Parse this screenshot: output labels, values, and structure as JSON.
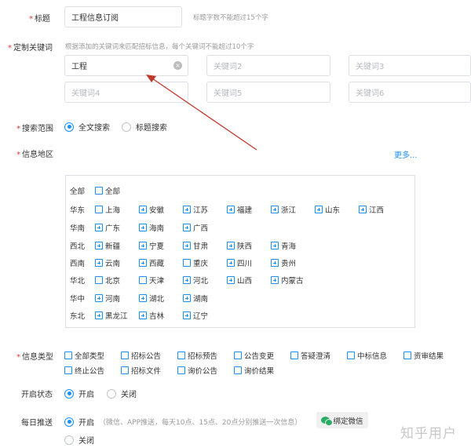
{
  "title_field": {
    "label": "标题",
    "value": "工程信息订阅",
    "hint": "标题字数不能超过15个字"
  },
  "keywords": {
    "label": "定制关键词",
    "hint": "根据添加的关键词来匹配招标信息，每个关键词不能超过10个字",
    "items": [
      {
        "value": "工程",
        "placeholder": ""
      },
      {
        "value": "",
        "placeholder": "关键词2"
      },
      {
        "value": "",
        "placeholder": "关键词3"
      },
      {
        "value": "",
        "placeholder": "关键词4"
      },
      {
        "value": "",
        "placeholder": "关键词5"
      },
      {
        "value": "",
        "placeholder": "关键词6"
      }
    ]
  },
  "search_scope": {
    "label": "搜索范围",
    "options": [
      {
        "label": "全文搜索",
        "selected": true
      },
      {
        "label": "标题搜索",
        "selected": false
      }
    ]
  },
  "region": {
    "label": "信息地区",
    "more": "更多...",
    "rows": [
      {
        "name": "全部",
        "items": [
          "全部"
        ]
      },
      {
        "name": "华东",
        "items": [
          "上海",
          "安徽",
          "江苏",
          "福建",
          "浙江",
          "山东",
          "江西"
        ]
      },
      {
        "name": "华南",
        "items": [
          "广东",
          "海南",
          "广西"
        ]
      },
      {
        "name": "西北",
        "items": [
          "新疆",
          "宁夏",
          "甘肃",
          "陕西",
          "青海"
        ]
      },
      {
        "name": "西南",
        "items": [
          "云南",
          "西藏",
          "重庆",
          "四川",
          "贵州"
        ]
      },
      {
        "name": "华北",
        "items": [
          "北京",
          "天津",
          "河北",
          "山西",
          "内蒙古"
        ]
      },
      {
        "name": "华中",
        "items": [
          "河南",
          "湖北",
          "湖南"
        ]
      },
      {
        "name": "东北",
        "items": [
          "黑龙江",
          "吉林",
          "辽宁"
        ]
      }
    ]
  },
  "info_type": {
    "label": "信息类型",
    "items": [
      "全部类型",
      "招标公告",
      "招标预告",
      "公告变更",
      "答疑澄清",
      "中标信息",
      "资审结果",
      "终止公告",
      "招标文件",
      "询价公告",
      "询价结果"
    ]
  },
  "status": {
    "label": "开启状态",
    "options": [
      {
        "label": "开启",
        "selected": true
      },
      {
        "label": "关闭",
        "selected": false
      }
    ]
  },
  "daily_push": {
    "label": "每日推送",
    "on_label": "开启",
    "on_note": "（微信、APP推送，每天10点、15点、20点分别推送一次信息）",
    "off_label": "关闭",
    "bind_button": "绑定微信"
  },
  "watermark": "知乎用户",
  "colors": {
    "accent": "#1890ff",
    "required": "#e53935",
    "arrow": "#c0392b"
  }
}
